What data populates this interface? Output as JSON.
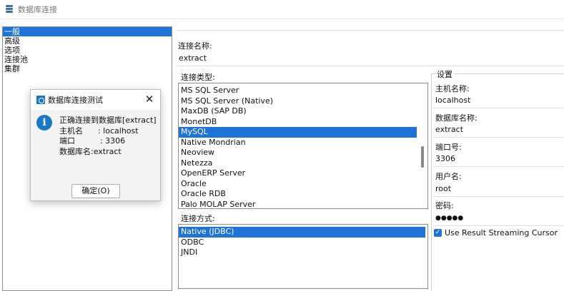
{
  "window": {
    "title": "数据库连接",
    "icon": "database-icon"
  },
  "nav": {
    "items": [
      {
        "label": "一般",
        "selected": true
      },
      {
        "label": "高级",
        "selected": false
      },
      {
        "label": "选项",
        "selected": false
      },
      {
        "label": "连接池",
        "selected": false
      },
      {
        "label": "集群",
        "selected": false
      }
    ]
  },
  "connection_name": {
    "label": "连接名称:",
    "value": "extract"
  },
  "connection_type": {
    "label": "连接类型:",
    "items": [
      "MS SQL Server",
      "MS SQL Server (Native)",
      "MaxDB (SAP DB)",
      "MonetDB",
      "MySQL",
      "Native Mondrian",
      "Neoview",
      "Netezza",
      "OpenERP Server",
      "Oracle",
      "Oracle RDB",
      "Palo MOLAP Server"
    ],
    "selected": "MySQL"
  },
  "access_method": {
    "label": "连接方式:",
    "items": [
      "Native (JDBC)",
      "ODBC",
      "JNDI"
    ],
    "selected": "Native (JDBC)"
  },
  "settings": {
    "group_label": "设置",
    "host_label": "主机名称:",
    "host_value": "localhost",
    "db_label": "数据库名称:",
    "db_value": "extract",
    "port_label": "端口号:",
    "port_value": "3306",
    "user_label": "用户名:",
    "user_value": "root",
    "password_label": "密码:",
    "password_value": "●●●●●",
    "streaming_label": "Use Result Streaming Cursor",
    "streaming_checked": true
  },
  "dialog": {
    "title": "数据库连接测试",
    "close_icon": "close-icon",
    "info_icon": "info-icon",
    "line1": "正确连接到数据库[extract]",
    "line2": "主机名      : localhost",
    "line3": "端口          : 3306",
    "line4": "数据库名:extract",
    "ok_label": "确定(O)"
  },
  "colors": {
    "selection": "#1e73d6",
    "info": "#1b78c8"
  }
}
